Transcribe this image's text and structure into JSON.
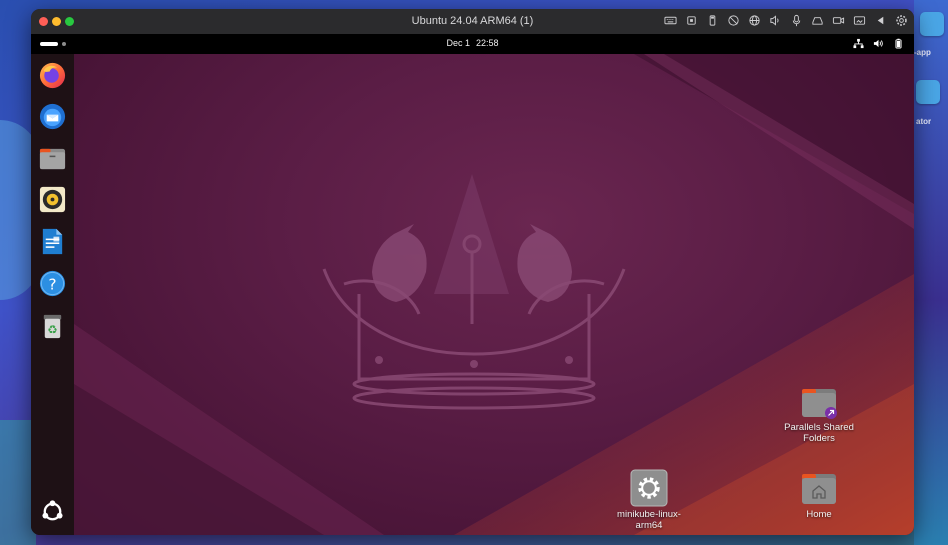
{
  "mac_desktop": {
    "side_labels": [
      "-app",
      "ator"
    ]
  },
  "window": {
    "title": "Ubuntu 24.04 ARM64 (1)",
    "toolbar_icons": [
      "keyboard-icon",
      "cpu-icon",
      "usb-icon",
      "camera-off-icon",
      "globe-icon",
      "speaker-icon",
      "microphone-icon",
      "drive-icon",
      "video-icon",
      "folder-icon",
      "back-icon",
      "gear-icon"
    ]
  },
  "topbar": {
    "date": "Dec 1",
    "time": "22:58",
    "tray_icons": [
      "network-icon",
      "volume-icon",
      "battery-icon"
    ]
  },
  "dock": {
    "apps": [
      "firefox-icon",
      "thunderbird-icon",
      "files-icon",
      "rhythmbox-icon",
      "writer-icon",
      "help-icon",
      "trash-icon"
    ],
    "show_apps": "app-grid-icon"
  },
  "desktop_icons": [
    {
      "label_line1": "Parallels Shared",
      "label_line2": "Folders",
      "icon": "shared-folder-icon"
    },
    {
      "label_line1": "minikube-linux-",
      "label_line2": "arm64",
      "icon": "executable-gear-icon"
    },
    {
      "label_line1": "Home",
      "label_line2": "",
      "icon": "home-folder-icon"
    }
  ],
  "colors": {
    "wallpaper": "#5a1d45",
    "dock": "#1e1115",
    "accent_orange": "#e95420"
  }
}
